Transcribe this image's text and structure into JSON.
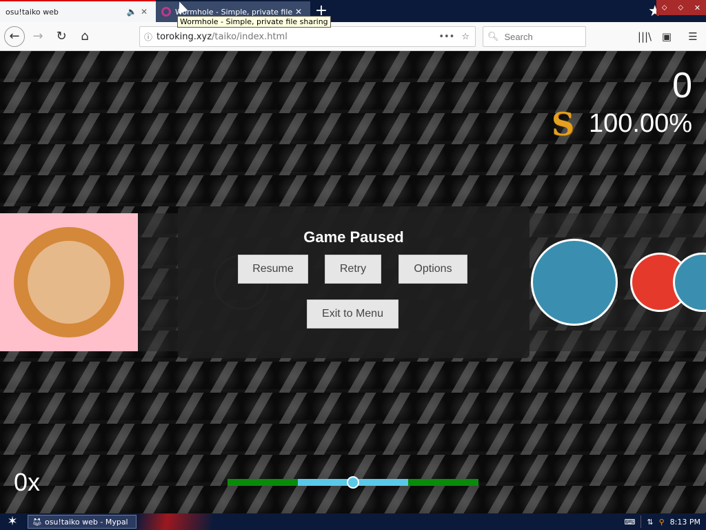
{
  "browser": {
    "tabs": [
      {
        "title": "osu!taiko web",
        "active": false,
        "icon": "speaker-icon"
      },
      {
        "title": "Wormhole - Simple, private file sharing",
        "active": true,
        "icon": "wormhole-favicon"
      }
    ],
    "tooltip": "Wormhole - Simple, private file sharing",
    "url": {
      "host": "toroking.xyz",
      "path": "/taiko/index.html"
    },
    "search_placeholder": "Search"
  },
  "game": {
    "score": "0",
    "rank": "S",
    "accuracy": "100.00%",
    "combo": "0x",
    "pause_menu": {
      "title": "Game Paused",
      "buttons": {
        "resume": "Resume",
        "retry": "Retry",
        "options": "Options",
        "exit": "Exit to Menu"
      }
    },
    "progress": {
      "value": 0.5
    },
    "colors": {
      "don": "#e53a2b",
      "kat": "#3a8fb0",
      "drum_bg": "#ffc0cb",
      "progress_track": "#0a8a0a",
      "progress_active": "#5ac8e8"
    }
  },
  "taskbar": {
    "item": "osu!taiko web - Mypal",
    "clock": "8:13 PM"
  }
}
